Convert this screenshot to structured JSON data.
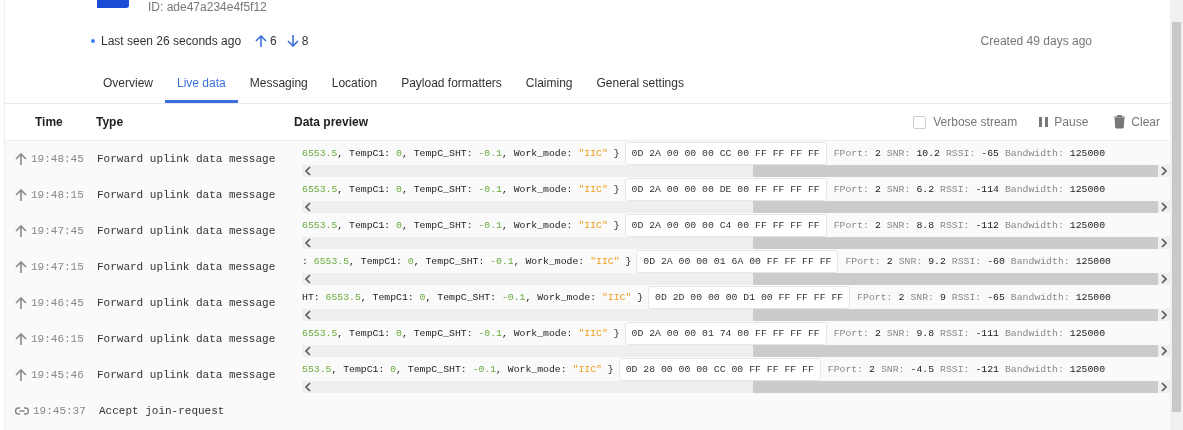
{
  "header": {
    "device_id": "ID: ade47a234e4f5f12",
    "last_seen": "Last seen 26 seconds ago",
    "uplink_count": "6",
    "downlink_count": "8",
    "created": "Created 49 days ago"
  },
  "tabs": [
    {
      "label": "Overview",
      "selected": false
    },
    {
      "label": "Live data",
      "selected": true
    },
    {
      "label": "Messaging",
      "selected": false
    },
    {
      "label": "Location",
      "selected": false
    },
    {
      "label": "Payload formatters",
      "selected": false
    },
    {
      "label": "Claiming",
      "selected": false
    },
    {
      "label": "General settings",
      "selected": false
    }
  ],
  "table": {
    "columns": [
      "Time",
      "Type",
      "Data preview"
    ],
    "verbose": {
      "label": "Verbose stream",
      "checked": false
    },
    "pause": "Pause",
    "clear": "Clear",
    "rows": [
      {
        "kind": "uplink",
        "time": "19:48:45",
        "type": "Forward uplink data message",
        "preview": [
          {
            "kind": "number",
            "text": "6553.5"
          },
          {
            "kind": "plain",
            "text": ", TempC1: "
          },
          {
            "kind": "number",
            "text": "0"
          },
          {
            "kind": "plain",
            "text": ", TempC_SHT: "
          },
          {
            "kind": "number",
            "text": "-0.1"
          },
          {
            "kind": "plain",
            "text": ", Work_mode: "
          },
          {
            "kind": "string",
            "text": "\"IIC\""
          },
          {
            "kind": "plain",
            "text": " }"
          }
        ],
        "payload": "0D 2A 00 00 00 CC 00 FF FF FF FF",
        "meta": [
          {
            "label": "FPort:",
            "value": "2"
          },
          {
            "label": "SNR:",
            "value": "10.2"
          },
          {
            "label": "RSSI:",
            "value": "-65"
          },
          {
            "label": "Bandwidth:",
            "value": "125000"
          }
        ]
      },
      {
        "kind": "uplink",
        "time": "19:48:15",
        "type": "Forward uplink data message",
        "preview": [
          {
            "kind": "number",
            "text": "6553.5"
          },
          {
            "kind": "plain",
            "text": ", TempC1: "
          },
          {
            "kind": "number",
            "text": "0"
          },
          {
            "kind": "plain",
            "text": ", TempC_SHT: "
          },
          {
            "kind": "number",
            "text": "-0.1"
          },
          {
            "kind": "plain",
            "text": ", Work_mode: "
          },
          {
            "kind": "string",
            "text": "\"IIC\""
          },
          {
            "kind": "plain",
            "text": " }"
          }
        ],
        "payload": "0D 2A 00 00 00 DE 00 FF FF FF FF",
        "meta": [
          {
            "label": "FPort:",
            "value": "2"
          },
          {
            "label": "SNR:",
            "value": "6.2"
          },
          {
            "label": "RSSI:",
            "value": "-114"
          },
          {
            "label": "Bandwidth:",
            "value": "125000"
          }
        ]
      },
      {
        "kind": "uplink",
        "time": "19:47:45",
        "type": "Forward uplink data message",
        "preview": [
          {
            "kind": "number",
            "text": "6553.5"
          },
          {
            "kind": "plain",
            "text": ", TempC1: "
          },
          {
            "kind": "number",
            "text": "0"
          },
          {
            "kind": "plain",
            "text": ", TempC_SHT: "
          },
          {
            "kind": "number",
            "text": "-0.1"
          },
          {
            "kind": "plain",
            "text": ", Work_mode: "
          },
          {
            "kind": "string",
            "text": "\"IIC\""
          },
          {
            "kind": "plain",
            "text": " }"
          }
        ],
        "payload": "0D 2A 00 00 00 C4 00 FF FF FF FF",
        "meta": [
          {
            "label": "FPort:",
            "value": "2"
          },
          {
            "label": "SNR:",
            "value": "8.8"
          },
          {
            "label": "RSSI:",
            "value": "-112"
          },
          {
            "label": "Bandwidth:",
            "value": "125000"
          }
        ]
      },
      {
        "kind": "uplink",
        "time": "19:47:15",
        "type": "Forward uplink data message",
        "preview": [
          {
            "kind": "plain",
            "text": ": "
          },
          {
            "kind": "number",
            "text": "6553.5"
          },
          {
            "kind": "plain",
            "text": ", TempC1: "
          },
          {
            "kind": "number",
            "text": "0"
          },
          {
            "kind": "plain",
            "text": ", TempC_SHT: "
          },
          {
            "kind": "number",
            "text": "-0.1"
          },
          {
            "kind": "plain",
            "text": ", Work_mode: "
          },
          {
            "kind": "string",
            "text": "\"IIC\""
          },
          {
            "kind": "plain",
            "text": " }"
          }
        ],
        "payload": "0D 2A 00 00 01 6A 00 FF FF FF FF",
        "meta": [
          {
            "label": "FPort:",
            "value": "2"
          },
          {
            "label": "SNR:",
            "value": "9.2"
          },
          {
            "label": "RSSI:",
            "value": "-60"
          },
          {
            "label": "Bandwidth:",
            "value": "125000"
          }
        ]
      },
      {
        "kind": "uplink",
        "time": "19:46:45",
        "type": "Forward uplink data message",
        "preview": [
          {
            "kind": "plain",
            "text": "HT: "
          },
          {
            "kind": "number",
            "text": "6553.5"
          },
          {
            "kind": "plain",
            "text": ", TempC1: "
          },
          {
            "kind": "number",
            "text": "0"
          },
          {
            "kind": "plain",
            "text": ", TempC_SHT: "
          },
          {
            "kind": "number",
            "text": "-0.1"
          },
          {
            "kind": "plain",
            "text": ", Work_mode: "
          },
          {
            "kind": "string",
            "text": "\"IIC\""
          },
          {
            "kind": "plain",
            "text": " }"
          }
        ],
        "payload": "0D 2D 00 00 00 D1 00 FF FF FF FF",
        "meta": [
          {
            "label": "FPort:",
            "value": "2"
          },
          {
            "label": "SNR:",
            "value": "9"
          },
          {
            "label": "RSSI:",
            "value": "-65"
          },
          {
            "label": "Bandwidth:",
            "value": "125000"
          }
        ]
      },
      {
        "kind": "uplink",
        "time": "19:46:15",
        "type": "Forward uplink data message",
        "preview": [
          {
            "kind": "number",
            "text": "6553.5"
          },
          {
            "kind": "plain",
            "text": ", TempC1: "
          },
          {
            "kind": "number",
            "text": "0"
          },
          {
            "kind": "plain",
            "text": ", TempC_SHT: "
          },
          {
            "kind": "number",
            "text": "-0.1"
          },
          {
            "kind": "plain",
            "text": ", Work_mode: "
          },
          {
            "kind": "string",
            "text": "\"IIC\""
          },
          {
            "kind": "plain",
            "text": " }"
          }
        ],
        "payload": "0D 2A 00 00 01 74 00 FF FF FF FF",
        "meta": [
          {
            "label": "FPort:",
            "value": "2"
          },
          {
            "label": "SNR:",
            "value": "9.8"
          },
          {
            "label": "RSSI:",
            "value": "-111"
          },
          {
            "label": "Bandwidth:",
            "value": "125000"
          }
        ]
      },
      {
        "kind": "uplink",
        "time": "19:45:46",
        "type": "Forward uplink data message",
        "preview": [
          {
            "kind": "number",
            "text": "553.5"
          },
          {
            "kind": "plain",
            "text": ", TempC1: "
          },
          {
            "kind": "number",
            "text": "0"
          },
          {
            "kind": "plain",
            "text": ", TempC_SHT: "
          },
          {
            "kind": "number",
            "text": "-0.1"
          },
          {
            "kind": "plain",
            "text": ", Work_mode: "
          },
          {
            "kind": "string",
            "text": "\"IIC\""
          },
          {
            "kind": "plain",
            "text": " }"
          }
        ],
        "payload": "0D 28 00 00 00 CC 00 FF FF FF FF",
        "meta": [
          {
            "label": "FPort:",
            "value": "2"
          },
          {
            "label": "SNR:",
            "value": "-4.5"
          },
          {
            "label": "RSSI:",
            "value": "-121"
          },
          {
            "label": "Bandwidth:",
            "value": "125000"
          }
        ]
      },
      {
        "kind": "join",
        "time": "19:45:37",
        "type": "Accept join-request"
      }
    ]
  }
}
